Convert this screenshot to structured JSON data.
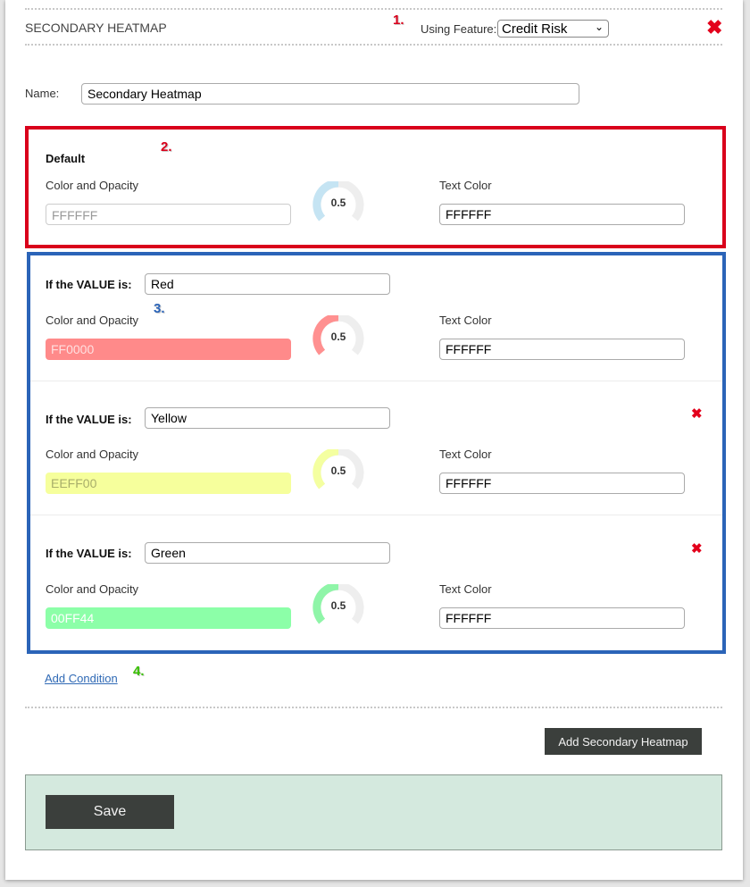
{
  "header": {
    "title": "SECONDARY HEATMAP",
    "feature_label": "Using Feature:",
    "feature_value": "Credit Risk",
    "annotation": "1."
  },
  "name": {
    "label": "Name:",
    "value": "Secondary Heatmap"
  },
  "default": {
    "annotation": "2.",
    "title": "Default",
    "color_label": "Color and Opacity",
    "color_value": "FFFFFF",
    "opacity": "0.5",
    "opacity_fraction": 0.5,
    "text_color_label": "Text Color",
    "text_color_value": "FFFFFF"
  },
  "conditions_annotation": "3.",
  "conditions": [
    {
      "value_label": "If the VALUE is:",
      "value": "Red",
      "color_label": "Color and Opacity",
      "color_value": "FF0000",
      "opacity": "0.5",
      "opacity_fraction": 0.5,
      "text_color_label": "Text Color",
      "text_color_value": "FFFFFF"
    },
    {
      "value_label": "If the VALUE is:",
      "value": "Yellow",
      "color_label": "Color and Opacity",
      "color_value": "EEFF00",
      "opacity": "0.5",
      "opacity_fraction": 0.5,
      "text_color_label": "Text Color",
      "text_color_value": "FFFFFF"
    },
    {
      "value_label": "If the VALUE is:",
      "value": "Green",
      "color_label": "Color and Opacity",
      "color_value": "00FF44",
      "opacity": "0.5",
      "opacity_fraction": 0.5,
      "text_color_label": "Text Color",
      "text_color_value": "FFFFFF"
    }
  ],
  "add_condition": {
    "label": "Add Condition",
    "annotation": "4."
  },
  "add_heatmap_label": "Add Secondary Heatmap",
  "save_label": "Save",
  "colors": {
    "default_swatch": "#ffffff",
    "red_swatch": "#ff8a8a",
    "yellow_swatch": "#f6ff9c",
    "green_swatch": "#8cffa8",
    "default_gauge": "#c5e4f3",
    "red_gauge": "#ff9090",
    "yellow_gauge": "#f4ffa0",
    "green_gauge": "#8ff5a8",
    "annotation_red": "#d9001b",
    "annotation_blue": "#2b64b8",
    "annotation_green": "#39c000"
  }
}
